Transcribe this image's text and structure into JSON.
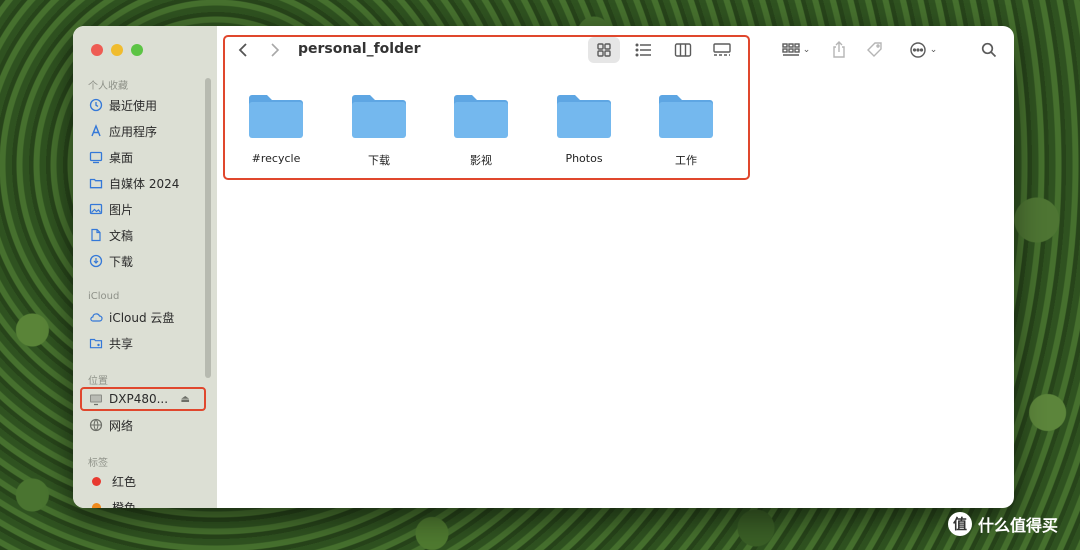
{
  "window": {
    "title": "personal_folder"
  },
  "sidebar": {
    "favorites_label": "个人收藏",
    "favorites": [
      {
        "label": "最近使用",
        "icon": "clock-icon"
      },
      {
        "label": "应用程序",
        "icon": "apps-icon"
      },
      {
        "label": "桌面",
        "icon": "desktop-icon"
      },
      {
        "label": "自媒体 2024",
        "icon": "folder-icon"
      },
      {
        "label": "图片",
        "icon": "photo-icon"
      },
      {
        "label": "文稿",
        "icon": "document-icon"
      },
      {
        "label": "下载",
        "icon": "download-icon"
      }
    ],
    "icloud_label": "iCloud",
    "icloud": [
      {
        "label": "iCloud 云盘",
        "icon": "cloud-icon"
      },
      {
        "label": "共享",
        "icon": "shared-folder-icon"
      }
    ],
    "locations_label": "位置",
    "locations": [
      {
        "label": "DXP480...",
        "icon": "monitor-icon"
      },
      {
        "label": "网络",
        "icon": "network-icon"
      }
    ],
    "tags_label": "标签",
    "tags": [
      {
        "label": "红色",
        "color": "#e8392f"
      },
      {
        "label": "橙色",
        "color": "#ef8a1c"
      }
    ]
  },
  "folders": [
    {
      "name": "#recycle"
    },
    {
      "name": "下载"
    },
    {
      "name": "影视"
    },
    {
      "name": "Photos"
    },
    {
      "name": "工作"
    }
  ],
  "watermark": {
    "logo": "值",
    "text": "什么值得买"
  },
  "colors": {
    "folder_body": "#74b8ee",
    "folder_tab": "#5ea6e3",
    "highlight": "#e0472d"
  }
}
